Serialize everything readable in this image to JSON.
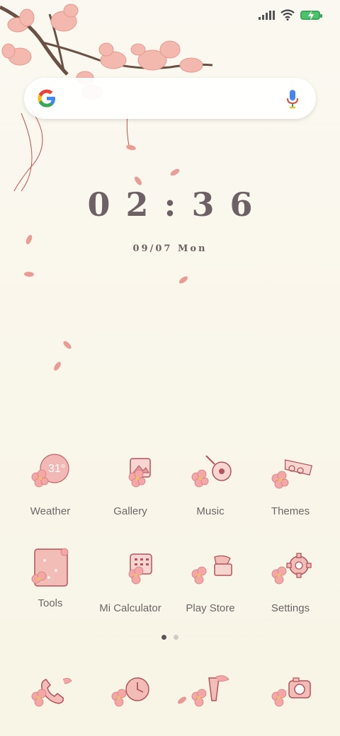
{
  "search": {
    "placeholder": ""
  },
  "clock": {
    "time": "02:36",
    "date": "09/07 Mon"
  },
  "weather": {
    "temp": "31°"
  },
  "apps_row1": [
    {
      "label": "Weather",
      "icon": "weather-icon"
    },
    {
      "label": "Gallery",
      "icon": "gallery-icon"
    },
    {
      "label": "Music",
      "icon": "music-icon"
    },
    {
      "label": "Themes",
      "icon": "themes-icon"
    }
  ],
  "apps_row2": [
    {
      "label": "Tools",
      "icon": "tools-icon"
    },
    {
      "label": "Mi Calculator",
      "icon": "calculator-icon"
    },
    {
      "label": "Play Store",
      "icon": "play-store-icon"
    },
    {
      "label": "Settings",
      "icon": "settings-icon"
    }
  ],
  "dock": [
    {
      "icon": "phone-icon"
    },
    {
      "icon": "messages-icon"
    },
    {
      "icon": "browser-icon"
    },
    {
      "icon": "camera-icon"
    }
  ],
  "colors": {
    "accent": "#e8a4a4",
    "icon_stroke": "#b6525a",
    "text": "#6d6668"
  }
}
